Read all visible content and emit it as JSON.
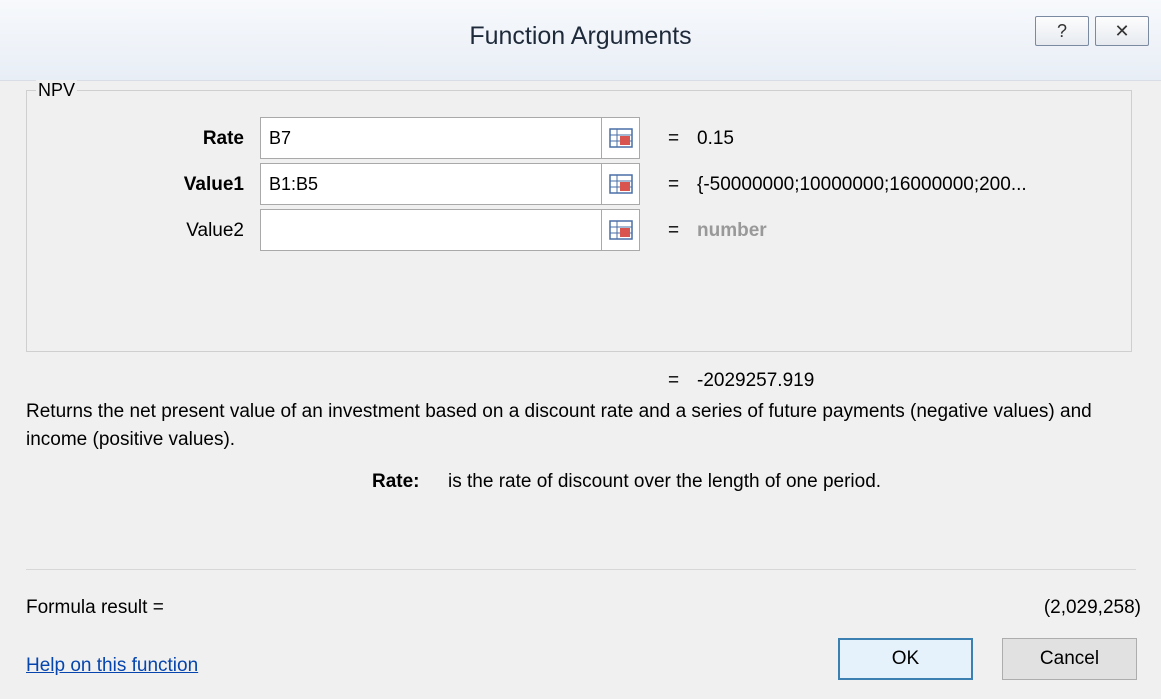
{
  "window": {
    "title": "Function Arguments",
    "help_label": "?",
    "close_label": "✕"
  },
  "function_group": {
    "label": "NPV"
  },
  "arguments": [
    {
      "label": "Rate",
      "bold": true,
      "input_value": "B7",
      "equals": "=",
      "evaluated": "0.15"
    },
    {
      "label": "Value1",
      "bold": true,
      "input_value": "B1:B5",
      "equals": "=",
      "evaluated": "{-50000000;10000000;16000000;200..."
    },
    {
      "label": "Value2",
      "bold": false,
      "input_value": "",
      "equals": "=",
      "evaluated": "number"
    }
  ],
  "result_preview": {
    "equals": "=",
    "value": "-2029257.919"
  },
  "description": "Returns the net present value of an investment based on a discount rate and a series of future payments (negative values) and income (positive values).",
  "argument_help": {
    "label": "Rate:",
    "text": "is the rate of discount over the length of one period."
  },
  "formula_result": {
    "label": "Formula result =",
    "value": "(2,029,258)"
  },
  "footer": {
    "help_link": "Help on this function",
    "ok_label": "OK",
    "cancel_label": "Cancel"
  },
  "colors": {
    "link": "#0645ad",
    "default_button_border": "#3c7fb1",
    "placeholder_text": "#999999"
  }
}
